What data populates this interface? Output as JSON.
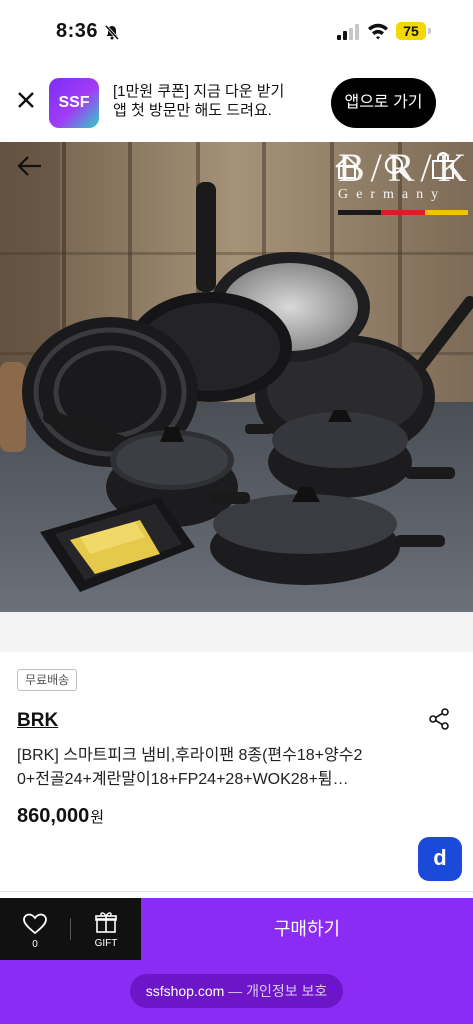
{
  "status_bar": {
    "time": "8:36",
    "battery": "75"
  },
  "app_banner": {
    "logo": "SSF",
    "message_line1": "[1만원 쿠폰] 지금 다운 받기",
    "message_line2": "앱 첫 방문만 해도 드려요.",
    "open_app_label": "앱으로 가기"
  },
  "hero": {
    "brand_mark": "B/R/K",
    "brand_sub": "Germany",
    "flag_colors": [
      "#1a1a1a",
      "#d81f26",
      "#f4c300"
    ]
  },
  "product": {
    "shipping_badge": "무료배송",
    "brand": "BRK",
    "title_line1": "[BRK] 스마트피크 냄비,후라이팬 8종(편수18+양수2",
    "title_line2": "0+전골24+계란말이18+FP24+28+WOK28+튐…",
    "price": "860,000",
    "currency": "원"
  },
  "floating_button": {
    "label": "d"
  },
  "bottom_bar": {
    "like_count": "0",
    "gift_label": "GIFT",
    "buy_label": "구매하기"
  },
  "browser": {
    "url": "ssfshop.com",
    "privacy": "— 개인정보 보호"
  },
  "colors": {
    "accent": "#8b2cf5",
    "dark": "#111111",
    "floating": "#1a4ad8"
  }
}
